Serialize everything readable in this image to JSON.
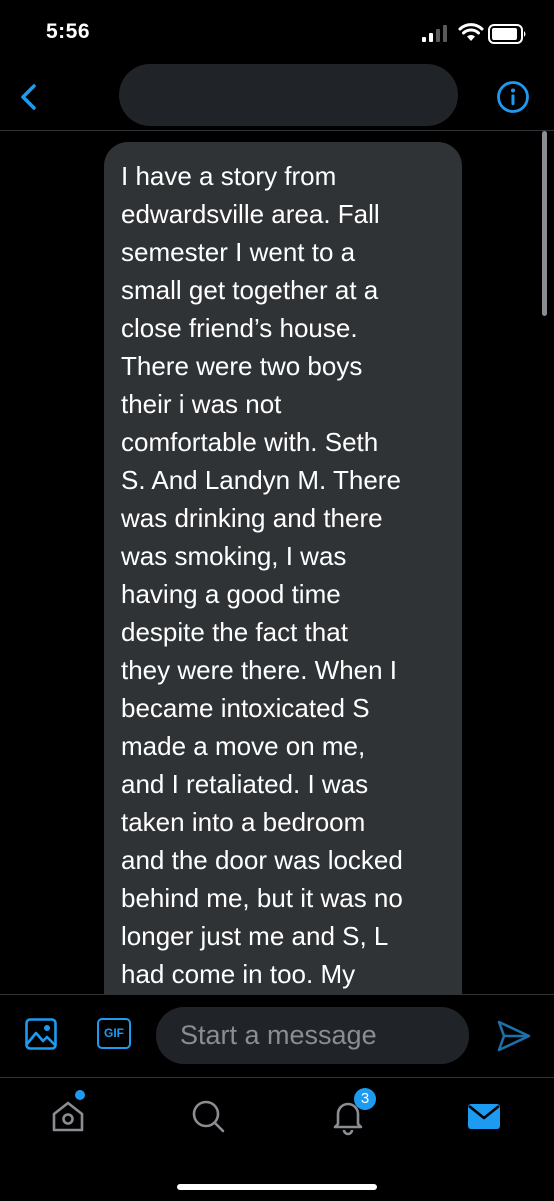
{
  "status_bar": {
    "time": "5:56",
    "signal_icon": "cellular-signal-icon",
    "wifi_icon": "wifi-icon",
    "battery_icon": "battery-icon"
  },
  "header": {
    "back_icon": "chevron-left-icon",
    "info_icon": "info-circle-icon",
    "conversation_name": ""
  },
  "message": {
    "lines": [
      "I have a story from",
      "edwardsville area. Fall",
      "semester I went to a",
      "small get together at a",
      "close friend’s house.",
      "There were two boys",
      "their i was not",
      "comfortable with. Seth",
      "S. And Landyn M. There",
      "was drinking and there",
      "was smoking, I was",
      "having a good time",
      "despite the fact that",
      "they were there. When I",
      "became intoxicated S",
      "made a move on me,",
      "and I retaliated. I was",
      "taken into a bedroom",
      "and the door was locked",
      "behind me, but it was no",
      "longer just me and S, L",
      "had come in too. My"
    ]
  },
  "composer": {
    "photo_icon": "image-icon",
    "gif_label": "GIF",
    "placeholder": "Start a message",
    "send_icon": "send-icon"
  },
  "tab_bar": {
    "home_icon": "home-icon",
    "search_icon": "search-icon",
    "notifications_icon": "bell-icon",
    "notifications_count": "3",
    "messages_icon": "envelope-icon"
  },
  "colors": {
    "accent": "#1d9bf0",
    "background": "#000000",
    "bubble": "#2f3336",
    "input": "#202327",
    "muted": "#8a8d91"
  }
}
